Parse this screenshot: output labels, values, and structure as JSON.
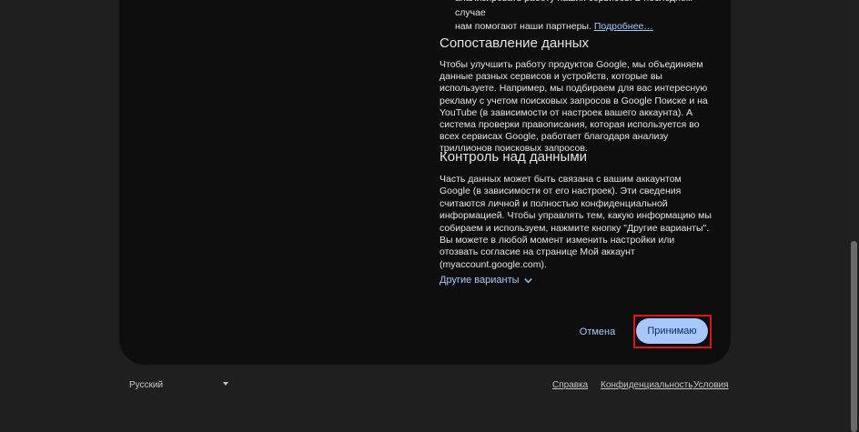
{
  "dialog": {
    "intro_bullet_line1": "анализировать работу наших сервисов. В последнем случае",
    "intro_bullet_line2": "нам помогают наши партнеры.",
    "intro_more_link": "Подробнее…",
    "section_data_title": "Сопоставление данных",
    "section_data_text": "Чтобы улучшить работу продуктов Google, мы объединяем данные разных сервисов и устройств, которые вы используете. Например, мы подбираем для вас интересную рекламу с учетом поисковых запросов в Google Поиске и на YouTube (в зависимости от настроек вашего аккаунта). А система проверки правописания, которая используется во всех сервисах Google, работает благодаря анализу триллионов поисковых запросов.",
    "section_control_title": "Контроль над данными",
    "section_control_text": "Часть данных может быть связана с вашим аккаунтом Google (в зависимости от его настроек). Эти сведения считаются личной и полностью конфиденциальной информацией. Чтобы управлять тем, какую информацию мы собираем и используем, нажмите кнопку \"Другие варианты\". Вы можете в любой момент изменить настройки или отозвать согласие на странице Мой аккаунт (myaccount.google.com).",
    "more_options_label": "Другие варианты",
    "cancel_label": "Отмена",
    "accept_label": "Принимаю"
  },
  "footer": {
    "language": "Русский",
    "help": "Справка",
    "privacy": "Конфиденциальность",
    "terms": "Условия"
  },
  "colors": {
    "accent": "#a8c7fa",
    "highlight_box": "#e0131a",
    "card_bg": "#0e0e0e",
    "page_bg": "#1f1f1f"
  }
}
